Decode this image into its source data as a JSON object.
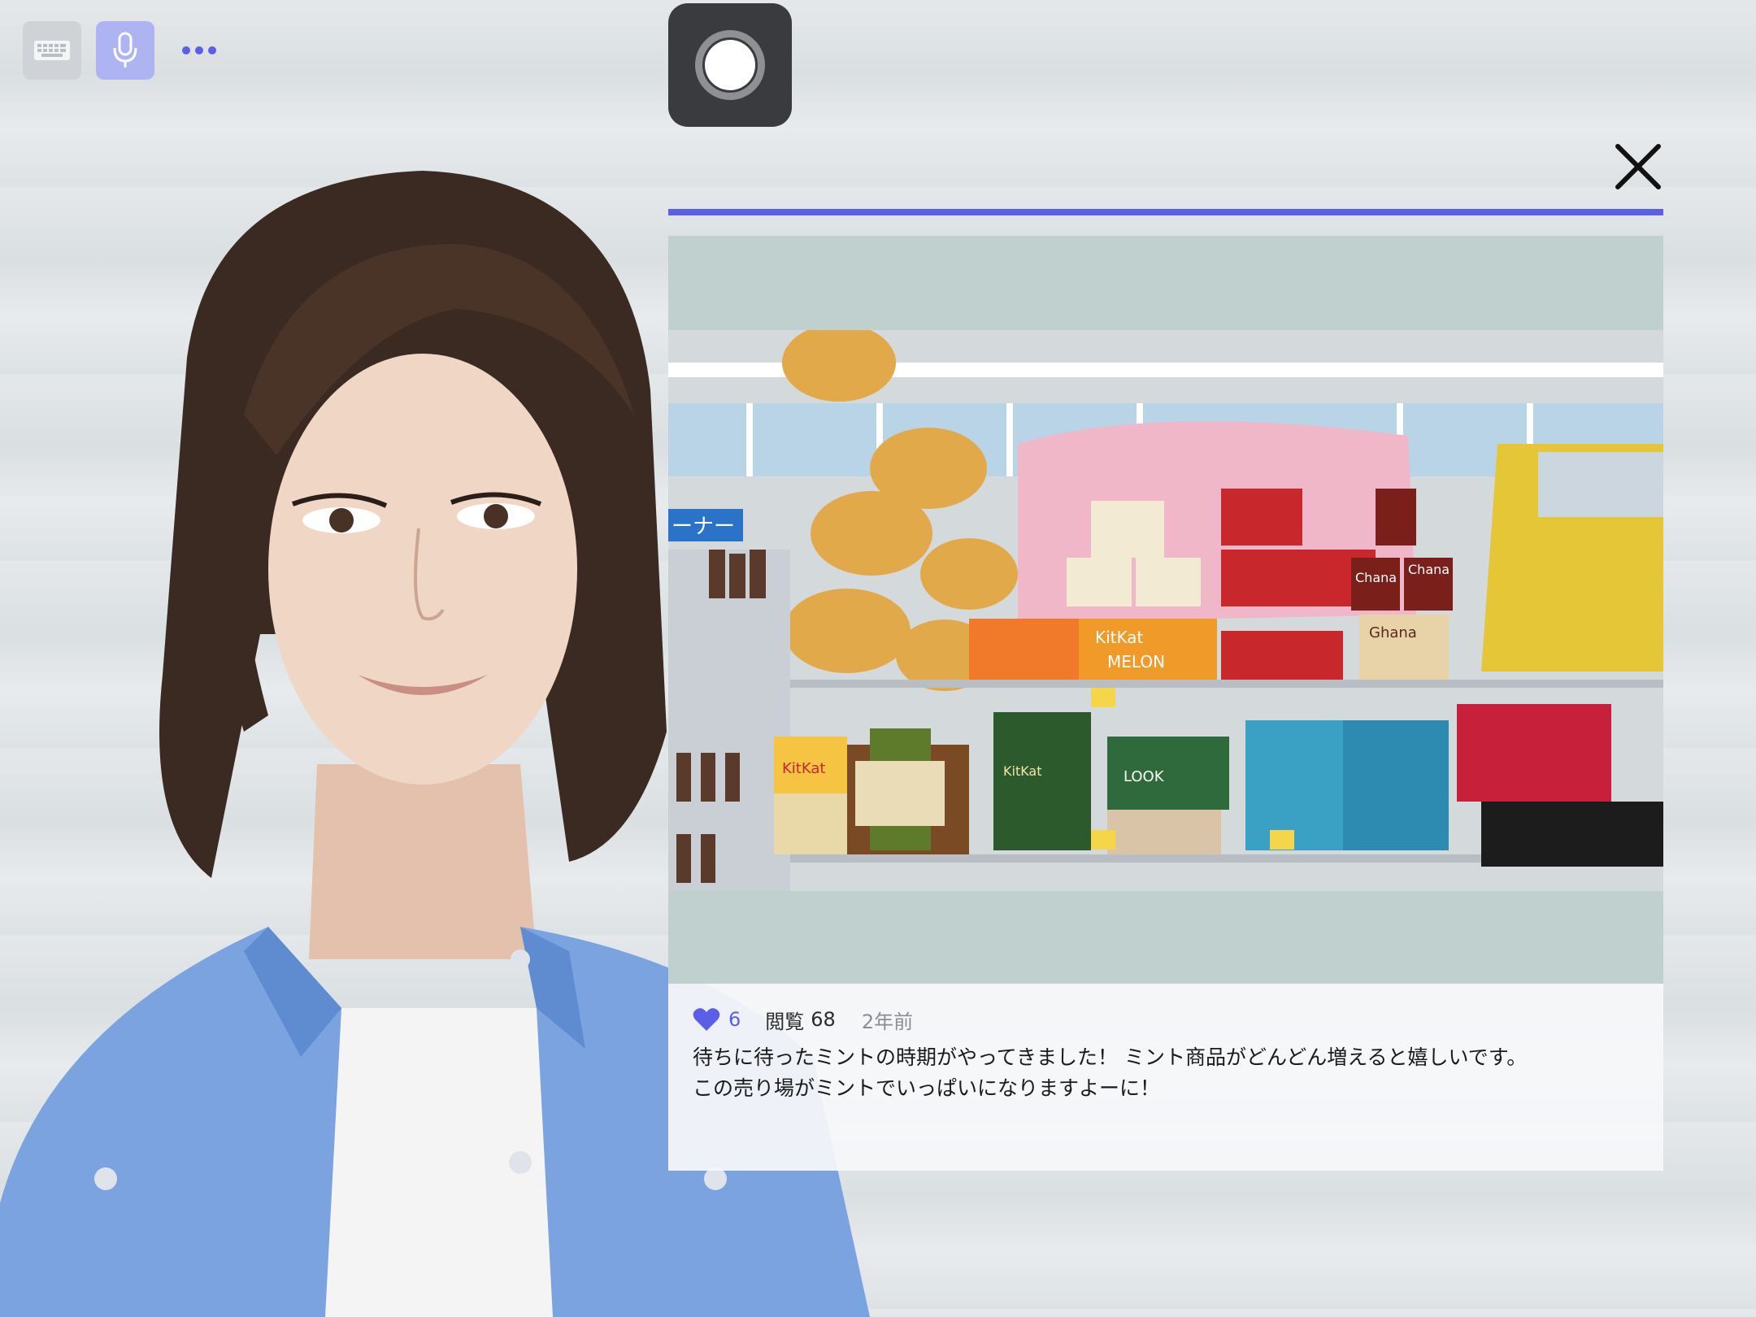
{
  "toolbar": {
    "keyboard_icon": "keyboard-icon",
    "mic_icon": "microphone-icon",
    "more_icon": "more-dots-icon",
    "record_icon": "record-icon",
    "close_icon": "close-icon",
    "accent": "#5b5ee6"
  },
  "post": {
    "likes": "6",
    "views_label": "閲覧",
    "views_count": "68",
    "time_ago": "2年前",
    "text_line1": "待ちに待ったミントの時期がやってきました！ ミント商品がどんどん増えると嬉しいです。",
    "text_line2": "この売り場がミントでいっぱいになりますよーに！"
  },
  "photo": {
    "sign_text": "ーナー",
    "labels": [
      "Chana",
      "Chana",
      "Ghana",
      "KitKat",
      "KitKat",
      "KitKat",
      "MELON",
      "LOOK"
    ]
  }
}
